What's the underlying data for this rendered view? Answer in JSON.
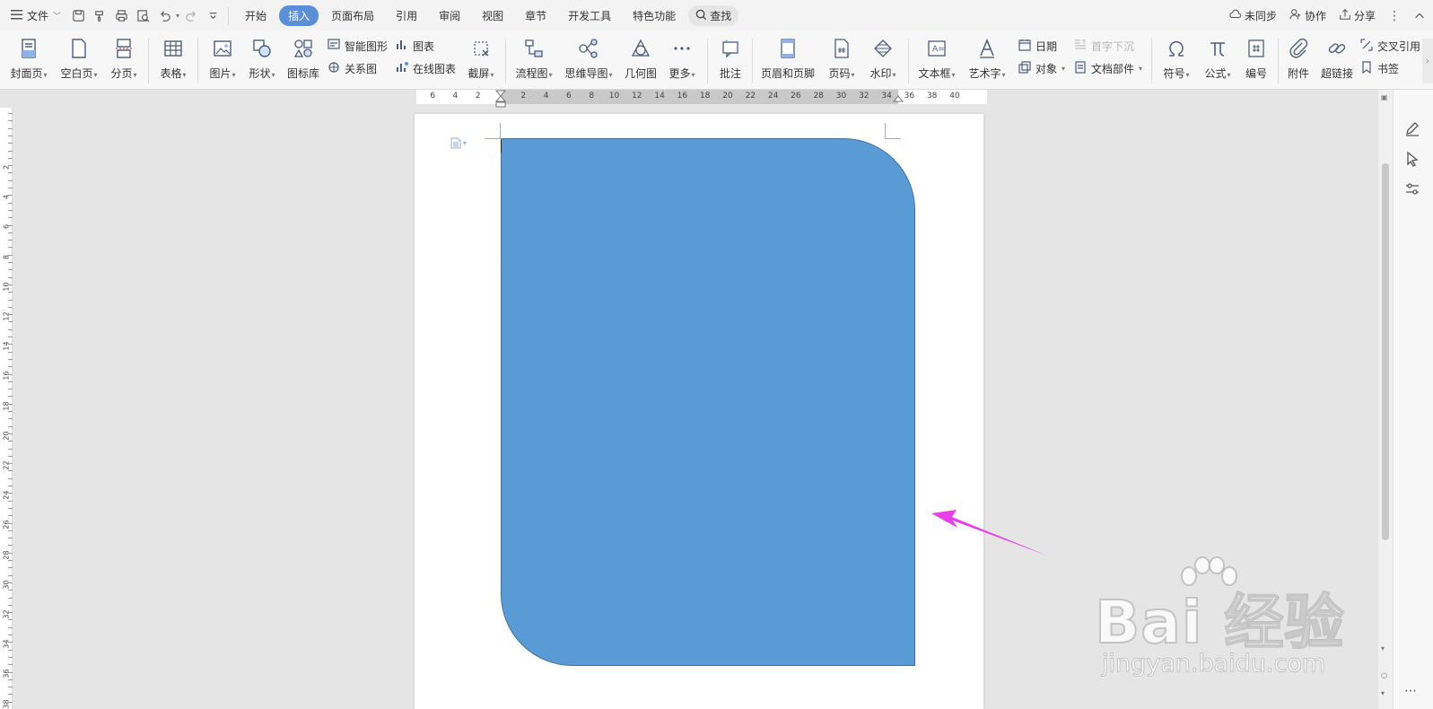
{
  "menubar": {
    "file_label": "文件",
    "tabs": [
      {
        "label": "开始"
      },
      {
        "label": "插入"
      },
      {
        "label": "页面布局"
      },
      {
        "label": "引用"
      },
      {
        "label": "审阅"
      },
      {
        "label": "视图"
      },
      {
        "label": "章节"
      },
      {
        "label": "开发工具"
      },
      {
        "label": "特色功能"
      }
    ],
    "active_tab": "插入",
    "search_label": "查找",
    "right": {
      "sync_label": "未同步",
      "collab_label": "协作",
      "share_label": "分享"
    }
  },
  "ribbon": {
    "cover": "封面页",
    "blank": "空白页",
    "pagebreak": "分页",
    "table": "表格",
    "picture": "图片",
    "shape": "形状",
    "iconlib": "图标库",
    "smartart": "智能图形",
    "relation": "关系图",
    "chart": "图表",
    "onlinechart": "在线图表",
    "screenshot": "截屏",
    "flowchart": "流程图",
    "mindmap": "思维导图",
    "geometry": "几何图",
    "more": "更多",
    "comment": "批注",
    "header_footer": "页眉和页脚",
    "pagenum": "页码",
    "watermark": "水印",
    "textbox": "文本框",
    "wordart": "艺术字",
    "date": "日期",
    "object": "对象",
    "dropcap": "首字下沉",
    "docpart": "文档部件",
    "symbol": "符号",
    "formula": "公式",
    "numbering": "编号",
    "attachment": "附件",
    "hyperlink": "超链接",
    "crossref": "交叉引用",
    "bookmark": "书签"
  },
  "ruler": {
    "h_numbers": [
      "6",
      "4",
      "2",
      "2",
      "4",
      "6",
      "8",
      "10",
      "12",
      "14",
      "16",
      "18",
      "20",
      "22",
      "24",
      "26",
      "28",
      "30",
      "32",
      "34",
      "36",
      "38",
      "40"
    ],
    "v_numbers": [
      "2",
      "4",
      "6",
      "8",
      "10",
      "12",
      "14",
      "16",
      "18",
      "20",
      "22",
      "24",
      "26",
      "28",
      "30",
      "32",
      "34",
      "36",
      "38"
    ]
  },
  "shape": {
    "fill": "#5b9bd5",
    "stroke": "#41719c"
  },
  "arrow": {
    "color": "#e83fe8"
  },
  "watermark": {
    "brand": "Bai 经验",
    "url": "jingyan.baidu.com"
  }
}
